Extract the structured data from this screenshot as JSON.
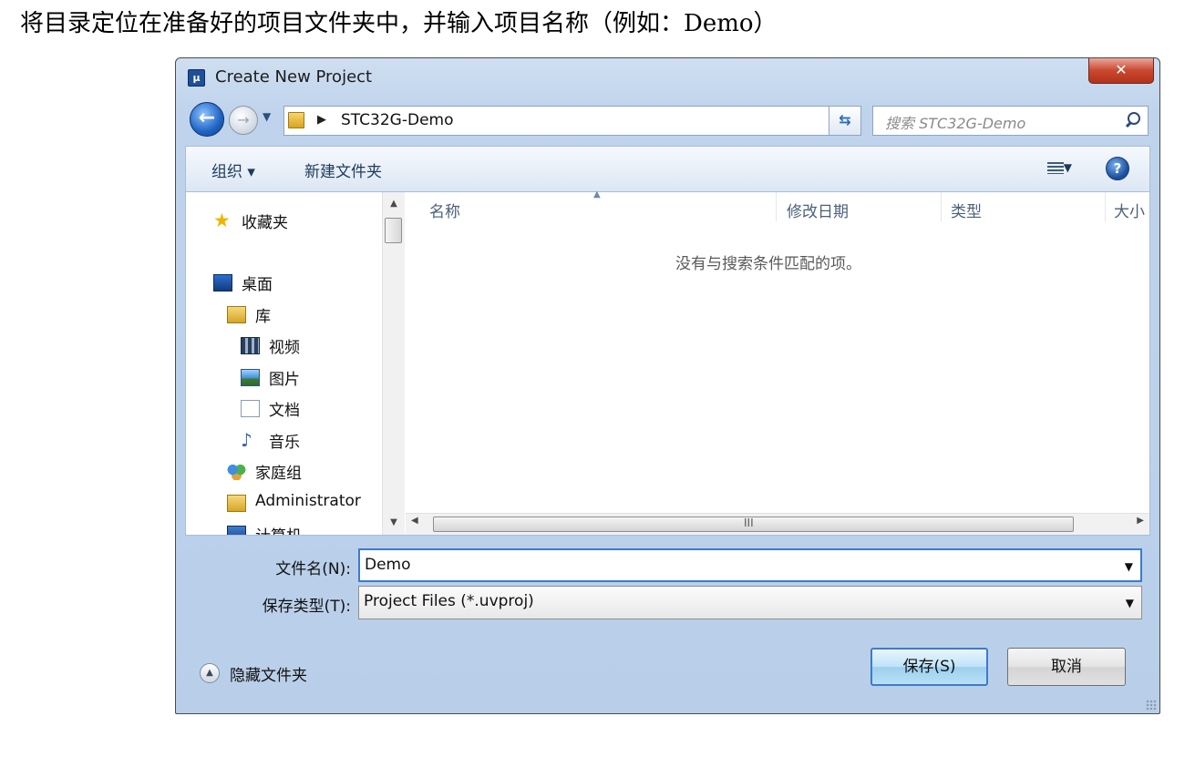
{
  "instruction": "将目录定位在准备好的项目文件夹中，并输入项目名称（例如：Demo）",
  "dialog": {
    "title": "Create New Project",
    "close_label": "✕"
  },
  "navbar": {
    "breadcrumb": "STC32G-Demo",
    "search_placeholder": "搜索 STC32G-Demo"
  },
  "toolbar": {
    "organize_label": "组织 ▾",
    "new_folder_label": "新建文件夹"
  },
  "nav_pane": {
    "items": [
      {
        "label": "收藏夹",
        "icon": "star-icon"
      },
      {
        "label": "桌面",
        "icon": "desktop-icon"
      },
      {
        "label": "库",
        "icon": "library-icon"
      },
      {
        "label": "视频",
        "icon": "video-icon"
      },
      {
        "label": "图片",
        "icon": "picture-icon"
      },
      {
        "label": "文档",
        "icon": "document-icon"
      },
      {
        "label": "音乐",
        "icon": "music-icon"
      },
      {
        "label": "家庭组",
        "icon": "homegroup-icon"
      },
      {
        "label": "Administrator",
        "icon": "user-folder-icon"
      },
      {
        "label": "计算机",
        "icon": "computer-icon"
      }
    ]
  },
  "file_list": {
    "columns": [
      "名称",
      "修改日期",
      "类型",
      "大小"
    ],
    "empty_message": "没有与搜索条件匹配的项。",
    "scroll_grip": "III"
  },
  "form": {
    "filename_label": "文件名(N):",
    "filename_value": "Demo",
    "filetype_label": "保存类型(T):",
    "filetype_value": "Project Files (*.uvproj)"
  },
  "footer": {
    "hide_folders_label": "隐藏文件夹",
    "save_label": "保存(S)",
    "cancel_label": "取消"
  },
  "colors": {
    "accent": "#3d7bcc",
    "chrome": "#bfd3ec",
    "close": "#c9482f"
  }
}
